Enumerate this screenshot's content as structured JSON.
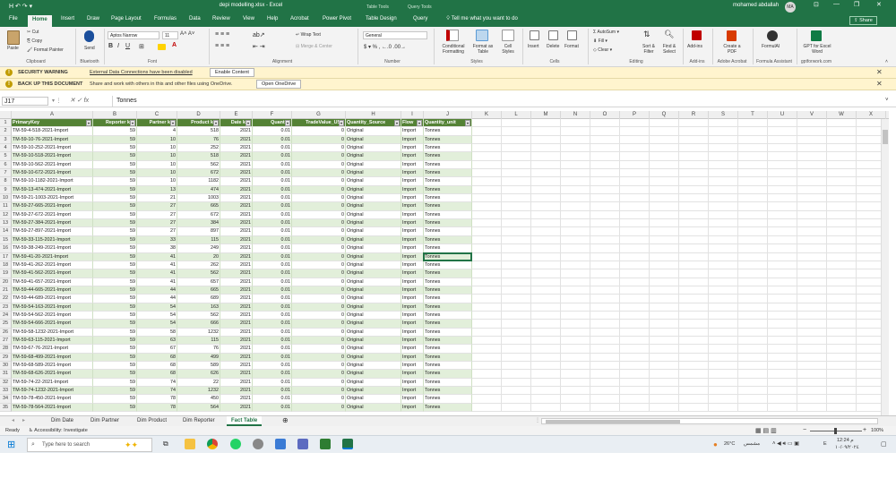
{
  "titlebar": {
    "title": "depi modelling.xlsx - Excel",
    "ctx1": "Table Tools",
    "ctx2": "Query Tools",
    "user": "mohamed abdallah",
    "avatar": "MA",
    "qat": "H  ↶  ↷  ▾"
  },
  "tabs": [
    "File",
    "Home",
    "Insert",
    "Draw",
    "Page Layout",
    "Formulas",
    "Data",
    "Review",
    "View",
    "Help",
    "Acrobat",
    "Power Pivot",
    "Table Design",
    "Query"
  ],
  "tellme": "Tell me what you want to do",
  "share": "Share",
  "ribbon": {
    "clipboard": {
      "paste": "Paste",
      "cut": "Cut",
      "copy": "Copy",
      "format_painter": "Format Painter",
      "label": "Clipboard"
    },
    "bluetooth": {
      "send": "Send",
      "label": "Bluetooth"
    },
    "font": {
      "name": "Aptos Narrow",
      "size": "11",
      "label": "Font"
    },
    "alignment": {
      "wrap": "Wrap Text",
      "merge": "Merge & Center",
      "label": "Alignment"
    },
    "number": {
      "format": "General",
      "label": "Number"
    },
    "styles": {
      "conditional": "Conditional Formatting",
      "format_table": "Format as Table",
      "cell_styles": "Cell Styles",
      "label": "Styles"
    },
    "cells": {
      "insert": "Insert",
      "delete": "Delete",
      "format": "Format",
      "label": "Cells"
    },
    "editing": {
      "autosum": "AutoSum",
      "fill": "Fill",
      "clear": "Clear",
      "sort": "Sort & Filter",
      "find": "Find & Select",
      "label": "Editing"
    },
    "addins": {
      "addins": "Add-ins",
      "label": "Add-ins"
    },
    "acrobat": {
      "create": "Create a PDF",
      "label": "Adobe Acrobat"
    },
    "formulaai": {
      "name": "FormulAI",
      "label": "Formula Assistant"
    },
    "gpt": {
      "name": "GPT for Excel Word",
      "label": "gptforwork.com"
    }
  },
  "security": {
    "title": "SECURITY WARNING",
    "text": "External Data Connections have been disabled",
    "button": "Enable Content"
  },
  "backup": {
    "title": "BACK UP THIS DOCUMENT",
    "text": "Share and work with others in this and other files using OneDrive.",
    "button": "Open OneDrive"
  },
  "formula": {
    "namebox": "J17",
    "fx": "fx",
    "value": "Tonnes"
  },
  "columns": [
    "A",
    "B",
    "C",
    "D",
    "E",
    "F",
    "G",
    "H",
    "I",
    "J",
    "K",
    "L",
    "M",
    "N",
    "O",
    "P",
    "Q",
    "R",
    "S",
    "T",
    "U",
    "V",
    "W",
    "X"
  ],
  "headers": [
    "PrimaryKey",
    "Reporter key",
    "Partner key",
    "Product key",
    "Date key",
    "Quantity",
    "TradeValue_USD",
    "Quantity_Source",
    "Flow",
    "Quantity_unit"
  ],
  "rows": [
    [
      "TM-59-4-518-2021-Import",
      "59",
      "4",
      "518",
      "2021",
      "0.01",
      "0",
      "Original",
      "Import",
      "Tonnes"
    ],
    [
      "TM-59-10-76-2021-Import",
      "59",
      "10",
      "76",
      "2021",
      "0.01",
      "0",
      "Original",
      "Import",
      "Tonnes"
    ],
    [
      "TM-59-10-252-2021-Import",
      "59",
      "10",
      "252",
      "2021",
      "0.01",
      "0",
      "Original",
      "Import",
      "Tonnes"
    ],
    [
      "TM-59-10-518-2021-Import",
      "59",
      "10",
      "518",
      "2021",
      "0.01",
      "0",
      "Original",
      "Import",
      "Tonnes"
    ],
    [
      "TM-59-10-562-2021-Import",
      "59",
      "10",
      "562",
      "2021",
      "0.01",
      "0",
      "Original",
      "Import",
      "Tonnes"
    ],
    [
      "TM-59-10-672-2021-Import",
      "59",
      "10",
      "672",
      "2021",
      "0.01",
      "0",
      "Original",
      "Import",
      "Tonnes"
    ],
    [
      "TM-59-10-1182-2021-Import",
      "59",
      "10",
      "1182",
      "2021",
      "0.01",
      "0",
      "Original",
      "Import",
      "Tonnes"
    ],
    [
      "TM-59-13-474-2021-Import",
      "59",
      "13",
      "474",
      "2021",
      "0.01",
      "0",
      "Original",
      "Import",
      "Tonnes"
    ],
    [
      "TM-59-21-1003-2021-Import",
      "59",
      "21",
      "1003",
      "2021",
      "0.01",
      "0",
      "Original",
      "Import",
      "Tonnes"
    ],
    [
      "TM-59-27-665-2021-Import",
      "59",
      "27",
      "665",
      "2021",
      "0.01",
      "0",
      "Original",
      "Import",
      "Tonnes"
    ],
    [
      "TM-59-27-672-2021-Import",
      "59",
      "27",
      "672",
      "2021",
      "0.01",
      "0",
      "Original",
      "Import",
      "Tonnes"
    ],
    [
      "TM-59-27-384-2021-Import",
      "59",
      "27",
      "384",
      "2021",
      "0.01",
      "0",
      "Original",
      "Import",
      "Tonnes"
    ],
    [
      "TM-59-27-897-2021-Import",
      "59",
      "27",
      "897",
      "2021",
      "0.01",
      "0",
      "Original",
      "Import",
      "Tonnes"
    ],
    [
      "TM-59-33-115-2021-Import",
      "59",
      "33",
      "115",
      "2021",
      "0.01",
      "0",
      "Original",
      "Import",
      "Tonnes"
    ],
    [
      "TM-59-38-249-2021-Import",
      "59",
      "38",
      "249",
      "2021",
      "0.01",
      "0",
      "Original",
      "Import",
      "Tonnes"
    ],
    [
      "TM-59-41-20-2021-Import",
      "59",
      "41",
      "20",
      "2021",
      "0.01",
      "0",
      "Original",
      "Import",
      "Tonnes"
    ],
    [
      "TM-59-41-262-2021-Import",
      "59",
      "41",
      "262",
      "2021",
      "0.01",
      "0",
      "Original",
      "Import",
      "Tonnes"
    ],
    [
      "TM-59-41-562-2021-Import",
      "59",
      "41",
      "562",
      "2021",
      "0.01",
      "0",
      "Original",
      "Import",
      "Tonnes"
    ],
    [
      "TM-59-41-657-2021-Import",
      "59",
      "41",
      "657",
      "2021",
      "0.01",
      "0",
      "Original",
      "Import",
      "Tonnes"
    ],
    [
      "TM-59-44-665-2021-Import",
      "59",
      "44",
      "665",
      "2021",
      "0.01",
      "0",
      "Original",
      "Import",
      "Tonnes"
    ],
    [
      "TM-59-44-689-2021-Import",
      "59",
      "44",
      "689",
      "2021",
      "0.01",
      "0",
      "Original",
      "Import",
      "Tonnes"
    ],
    [
      "TM-59-54-163-2021-Import",
      "59",
      "54",
      "163",
      "2021",
      "0.01",
      "0",
      "Original",
      "Import",
      "Tonnes"
    ],
    [
      "TM-59-54-562-2021-Import",
      "59",
      "54",
      "562",
      "2021",
      "0.01",
      "0",
      "Original",
      "Import",
      "Tonnes"
    ],
    [
      "TM-59-54-666-2021-Import",
      "59",
      "54",
      "666",
      "2021",
      "0.01",
      "0",
      "Original",
      "Import",
      "Tonnes"
    ],
    [
      "TM-59-58-1232-2021-Import",
      "59",
      "58",
      "1232",
      "2021",
      "0.01",
      "0",
      "Original",
      "Import",
      "Tonnes"
    ],
    [
      "TM-59-63-115-2021-Import",
      "59",
      "63",
      "115",
      "2021",
      "0.01",
      "0",
      "Original",
      "Import",
      "Tonnes"
    ],
    [
      "TM-59-67-76-2021-Import",
      "59",
      "67",
      "76",
      "2021",
      "0.01",
      "0",
      "Original",
      "Import",
      "Tonnes"
    ],
    [
      "TM-59-68-499-2021-Import",
      "59",
      "68",
      "499",
      "2021",
      "0.01",
      "0",
      "Original",
      "Import",
      "Tonnes"
    ],
    [
      "TM-59-68-589-2021-Import",
      "59",
      "68",
      "589",
      "2021",
      "0.01",
      "0",
      "Original",
      "Import",
      "Tonnes"
    ],
    [
      "TM-59-68-626-2021-Import",
      "59",
      "68",
      "626",
      "2021",
      "0.01",
      "0",
      "Original",
      "Import",
      "Tonnes"
    ],
    [
      "TM-59-74-22-2021-Import",
      "59",
      "74",
      "22",
      "2021",
      "0.01",
      "0",
      "Original",
      "Import",
      "Tonnes"
    ],
    [
      "TM-59-74-1232-2021-Import",
      "59",
      "74",
      "1232",
      "2021",
      "0.01",
      "0",
      "Original",
      "Import",
      "Tonnes"
    ],
    [
      "TM-59-78-450-2021-Import",
      "59",
      "78",
      "450",
      "2021",
      "0.01",
      "0",
      "Original",
      "Import",
      "Tonnes"
    ],
    [
      "TM-59-78-564-2021-Import",
      "59",
      "78",
      "564",
      "2021",
      "0.01",
      "0",
      "Original",
      "Import",
      "Tonnes"
    ]
  ],
  "sheets": [
    "Dim Date",
    "Dim Partner",
    "Dim Product",
    "Dim Reporter",
    "Fact Table"
  ],
  "active_sheet": "Fact Table",
  "status": {
    "ready": "Ready",
    "accessibility": "Accessibility: Investigate",
    "zoom": "100%"
  },
  "taskbar": {
    "search_placeholder": "Type here to search",
    "weather": "26°C",
    "weather_desc": "مشمس",
    "time": "12:24 م",
    "date": "١٠/٠٩/٢٠٢٤",
    "lang": "E"
  }
}
